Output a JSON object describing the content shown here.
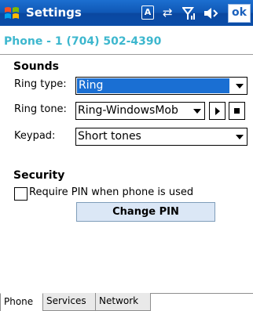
{
  "titlebar": {
    "title": "Settings",
    "ok_label": "ok",
    "status_icons": [
      "input-method-icon",
      "connectivity-icon",
      "signal-icon",
      "speaker-icon"
    ]
  },
  "header": {
    "phone_line": "Phone - 1 (704) 502-4390"
  },
  "sounds": {
    "heading": "Sounds",
    "ring_type": {
      "label": "Ring type:",
      "value": "Ring"
    },
    "ring_tone": {
      "label": "Ring tone:",
      "value": "Ring-WindowsMob"
    },
    "keypad": {
      "label": "Keypad:",
      "value": "Short tones"
    }
  },
  "security": {
    "heading": "Security",
    "require_pin_label": "Require PIN when phone is used",
    "require_pin_checked": false,
    "change_pin_label": "Change PIN"
  },
  "tabs": [
    {
      "label": "Phone",
      "active": true
    },
    {
      "label": "Services",
      "active": false
    },
    {
      "label": "Network",
      "active": false
    }
  ],
  "colors": {
    "titlebar": "#0f57b5",
    "phone_line": "#3db7ce",
    "selection": "#1a6fd3",
    "button": "#dbe7f6"
  }
}
